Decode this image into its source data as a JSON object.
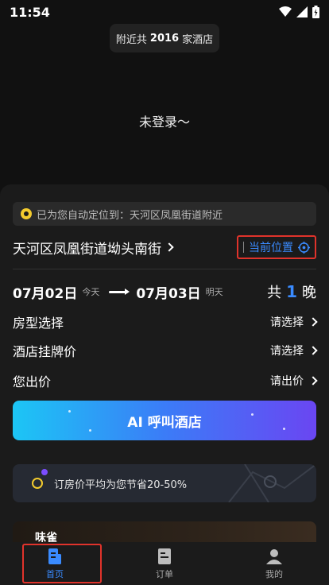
{
  "status_bar": {
    "time": "11:54"
  },
  "nearby": {
    "prefix": "附近共",
    "count": "2016",
    "suffix": "家酒店"
  },
  "login_prompt": "未登录～",
  "location_notice": "已为您自动定位到：天河区凤凰街道附近",
  "address": "天河区凤凰街道坳头南街",
  "current_location_label": "当前位置",
  "dates": {
    "checkin": "07月02日",
    "checkin_tag": "今天",
    "checkout": "07月03日",
    "checkout_tag": "明天",
    "nights_prefix": "共",
    "nights_count": "1",
    "nights_suffix": "晚"
  },
  "options": [
    {
      "label": "房型选择",
      "value": "请选择"
    },
    {
      "label": "酒店挂牌价",
      "value": "请选择"
    },
    {
      "label": "您出价",
      "value": "请出价"
    }
  ],
  "ai_button_label": "AI 呼叫酒店",
  "savings_text": "订房价平均为您节省20-50%",
  "promo_logo": "味雀",
  "nav": [
    {
      "label": "首页",
      "icon": "home-doc-icon",
      "active": true
    },
    {
      "label": "订单",
      "icon": "order-icon",
      "active": false
    },
    {
      "label": "我的",
      "icon": "profile-icon",
      "active": false
    }
  ],
  "colors": {
    "accent": "#3a8bff",
    "highlight": "#e0332b",
    "pin": "#f3cb2e"
  }
}
